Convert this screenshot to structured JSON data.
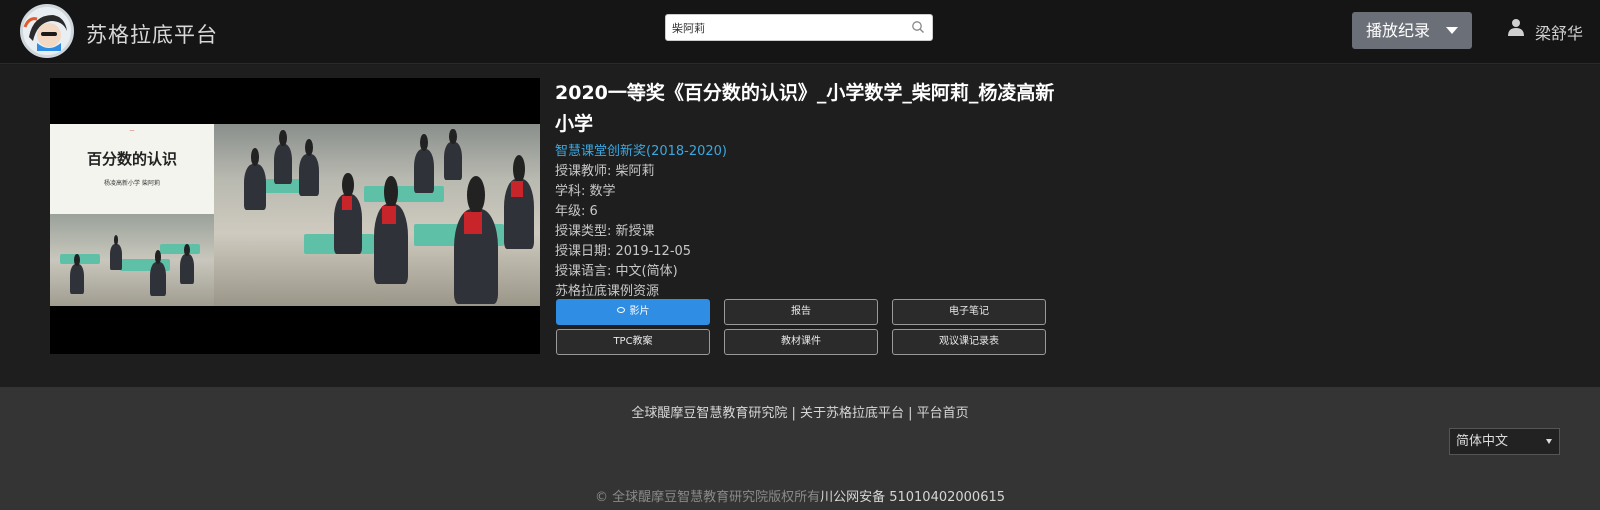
{
  "header": {
    "brand": "苏格拉底平台",
    "search_value": "柴阿莉",
    "play_log_label": "播放纪录",
    "username": "梁舒华"
  },
  "video": {
    "slide_title": "百分数的认识",
    "slide_subtitle": "杨凌高新小学 柴阿莉"
  },
  "lesson": {
    "title": "2020一等奖《百分数的认识》_小学数学_柴阿莉_杨凌高新小学",
    "award": "智慧课堂创新奖(2018-2020)",
    "meta": [
      "授课教师: 柴阿莉",
      "学科: 数学",
      "年级: 6",
      "授课类型: 新授课",
      "授课日期: 2019-12-05",
      "授课语言: 中文(简体)",
      "苏格拉底课例资源"
    ],
    "buttons": [
      "影片",
      "报告",
      "电子笔记",
      "TPC教案",
      "教材课件",
      "观议课记录表"
    ]
  },
  "footer": {
    "links": "全球醍摩豆智慧教育研究院 | 关于苏格拉底平台 | 平台首页",
    "language": "简体中文",
    "copyright": "© 全球醍摩豆智慧教育研究院版权所有",
    "icp": "川公网安备 51010402000615"
  },
  "colors": {
    "accent": "#2f8de4",
    "award_link": "#3aa8e0",
    "header_bg": "#151515",
    "footer_bg": "#343434"
  }
}
